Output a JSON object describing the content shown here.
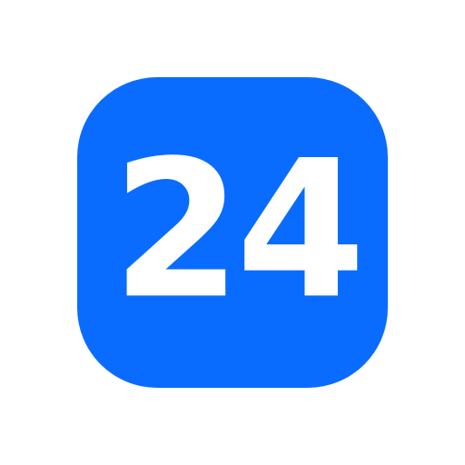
{
  "icon": {
    "label": "24",
    "tile_color": "#0A6CFF",
    "text_color": "#FFFFFF",
    "background_color": "#FFFFFF"
  }
}
